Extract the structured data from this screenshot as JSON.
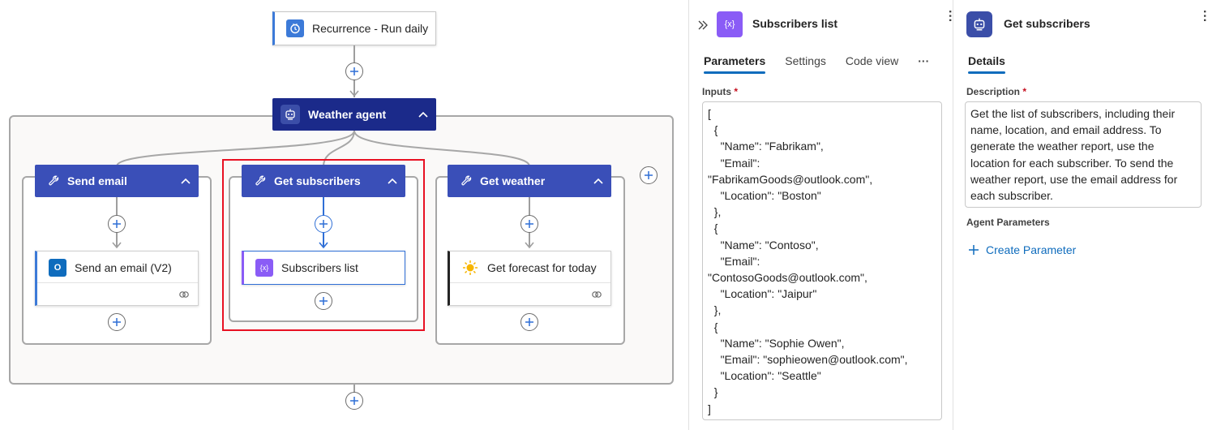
{
  "trigger": {
    "label": "Recurrence - Run daily",
    "icon": "recurrence-icon",
    "color": "#3c7ad8"
  },
  "agent": {
    "label": "Weather agent",
    "icon": "robot-icon",
    "color": "#1b2a8a"
  },
  "tools": [
    {
      "label": "Send email",
      "action": "Send an email (V2)",
      "action_icon": "outlook-icon"
    },
    {
      "label": "Get subscribers",
      "action": "Subscribers list",
      "action_icon": "variable-icon"
    },
    {
      "label": "Get weather",
      "action": "Get forecast for today",
      "action_icon": "sun-icon"
    }
  ],
  "panel1": {
    "title": "Subscribers list",
    "tabs": [
      "Parameters",
      "Settings",
      "Code view"
    ],
    "active_tab": "Parameters",
    "inputs_label": "Inputs",
    "required_mark": "*",
    "inputs_value": "[\n  {\n    \"Name\": \"Fabrikam\",\n    \"Email\":\n\"FabrikamGoods@outlook.com\",\n    \"Location\": \"Boston\"\n  },\n  {\n    \"Name\": \"Contoso\",\n    \"Email\":\n\"ContosoGoods@outlook.com\",\n    \"Location\": \"Jaipur\"\n  },\n  {\n    \"Name\": \"Sophie Owen\",\n    \"Email\": \"sophieowen@outlook.com\",\n    \"Location\": \"Seattle\"\n  }\n]"
  },
  "panel2": {
    "title": "Get subscribers",
    "tab": "Details",
    "description_label": "Description",
    "required_mark": "*",
    "description_value": "Get the list of subscribers, including their name, location, and email address. To generate the weather report, use the location for each subscriber. To send the weather report, use the email address for each subscriber.",
    "agent_params_label": "Agent Parameters",
    "create_param_label": "Create Parameter"
  },
  "colors": {
    "accent": "#0f6cbd",
    "selection": "#e81123",
    "tool_header": "#3a4fb8"
  }
}
